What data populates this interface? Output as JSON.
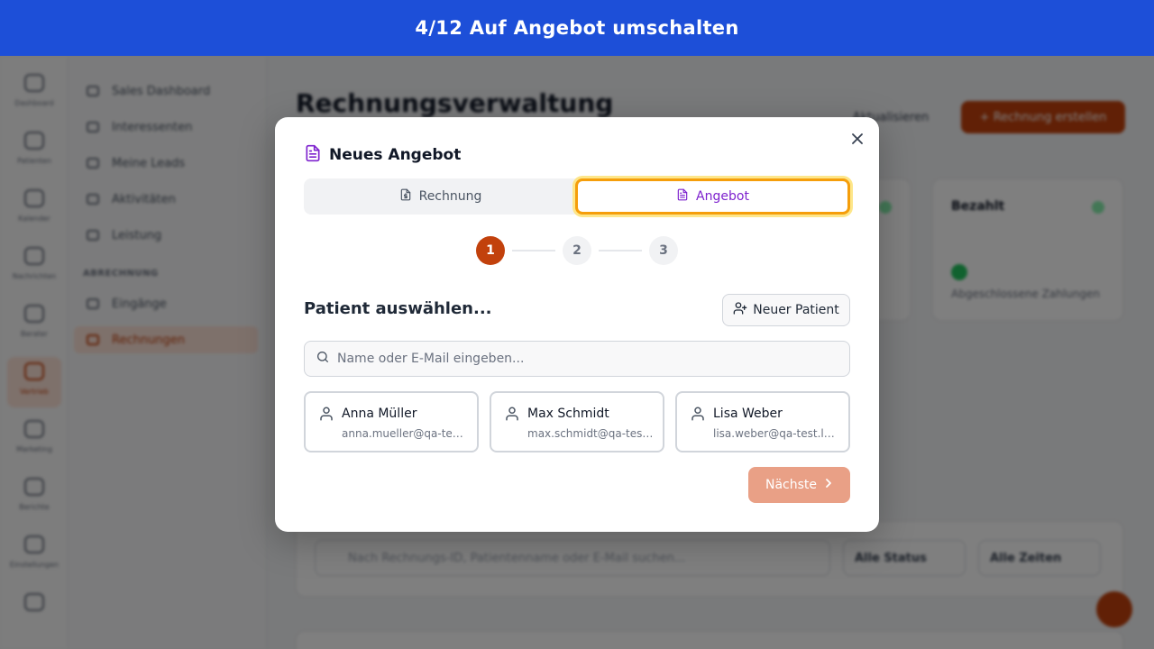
{
  "banner": {
    "text": "4/12 Auf Angebot umschalten"
  },
  "background": {
    "page_title": "Rechnungsverwaltung",
    "refresh_label": "Aktualisieren",
    "create_label": "+ Rechnung erstellen",
    "sidebar": {
      "items": [
        "Sales Dashboard",
        "Interessenten",
        "Meine Leads",
        "Aktivitäten",
        "Leistung"
      ],
      "section": "ABRECHNUNG",
      "billing_items": [
        "Eingänge",
        "Rechnungen"
      ]
    },
    "stat_card": {
      "title": "Bezahlt",
      "subtitle": "Abgeschlossene Zahlungen"
    },
    "filters": {
      "search_placeholder": "Nach Rechnungs-ID, Patientenname oder E-Mail suchen...",
      "status": "Alle Status",
      "date": "Alle Zeiten"
    }
  },
  "modal": {
    "title": "Neues Angebot",
    "title_icon": "document-icon",
    "close_icon": "close-icon",
    "tabs": [
      {
        "label": "Rechnung",
        "icon": "invoice-icon",
        "active": false
      },
      {
        "label": "Angebot",
        "icon": "document-icon",
        "active": true
      }
    ],
    "steps": [
      "1",
      "2",
      "3"
    ],
    "current_step": 1,
    "section_title": "Patient auswählen...",
    "new_patient_label": "Neuer Patient",
    "search_placeholder": "Name oder E-Mail eingeben...",
    "patients": [
      {
        "name": "Anna Müller",
        "email": "anna.mueller@qa-test.local"
      },
      {
        "name": "Max Schmidt",
        "email": "max.schmidt@qa-test.local"
      },
      {
        "name": "Lisa Weber",
        "email": "lisa.weber@qa-test.local"
      }
    ],
    "next_label": "Nächste",
    "colors": {
      "accent": "#c2410c",
      "tab_active": "#7e22ce",
      "highlight": "#f59e0b",
      "banner": "#1d4fd8"
    }
  }
}
